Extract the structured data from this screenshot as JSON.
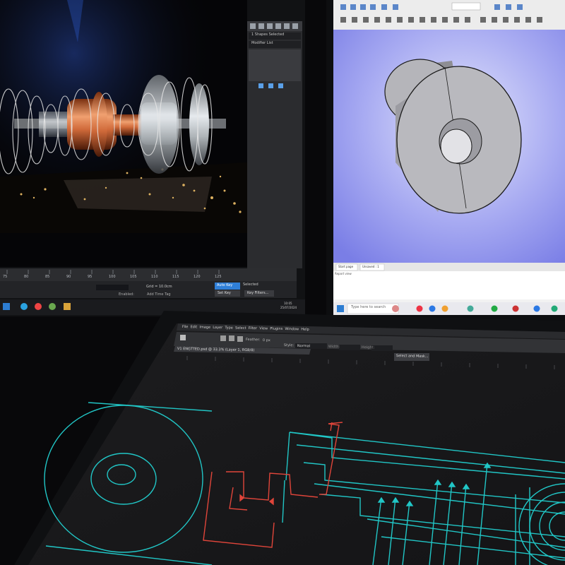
{
  "monitor_left": {
    "panel_title": "1 Shapes Selected",
    "modifier_list": "Modifier List",
    "ruler_ticks": [
      "75",
      "80",
      "85",
      "90",
      "95",
      "100",
      "105",
      "110",
      "115",
      "120",
      "125"
    ],
    "grid_label": "Grid = 10.0cm",
    "auto_key": "Auto Key",
    "selected": "Selected",
    "set_key": "Set Key",
    "key_filters": "Key Filters...",
    "enabled": "Enabled:",
    "add_time_tag": "Add Time Tag",
    "clock_time": "10:05",
    "clock_date": "25/07/2024"
  },
  "monitor_right": {
    "tab_start": "Start page",
    "tab_unsaved": "Unsaved : 1",
    "report_view": "Report view",
    "search_placeholder": "Type here to search"
  },
  "tablet": {
    "menu": [
      "File",
      "Edit",
      "Image",
      "Layer",
      "Type",
      "Select",
      "Filter",
      "View",
      "Plugins",
      "Window",
      "Help"
    ],
    "doc_title": "V1 ENGTTED.psd @ 33.3% (Layer 1, RGB/8)",
    "feather": "Feather:",
    "feather_value": "0 px",
    "style_label": "Style:",
    "style_value": "Normal",
    "width_label": "Width:",
    "height_label": "Height:",
    "select_mask": "Select and Mask..."
  },
  "colors": {
    "cyan": "#21c6c6",
    "red": "#e0453a",
    "copper": "#c8703f",
    "cad_bg": "#6b6fe0"
  }
}
